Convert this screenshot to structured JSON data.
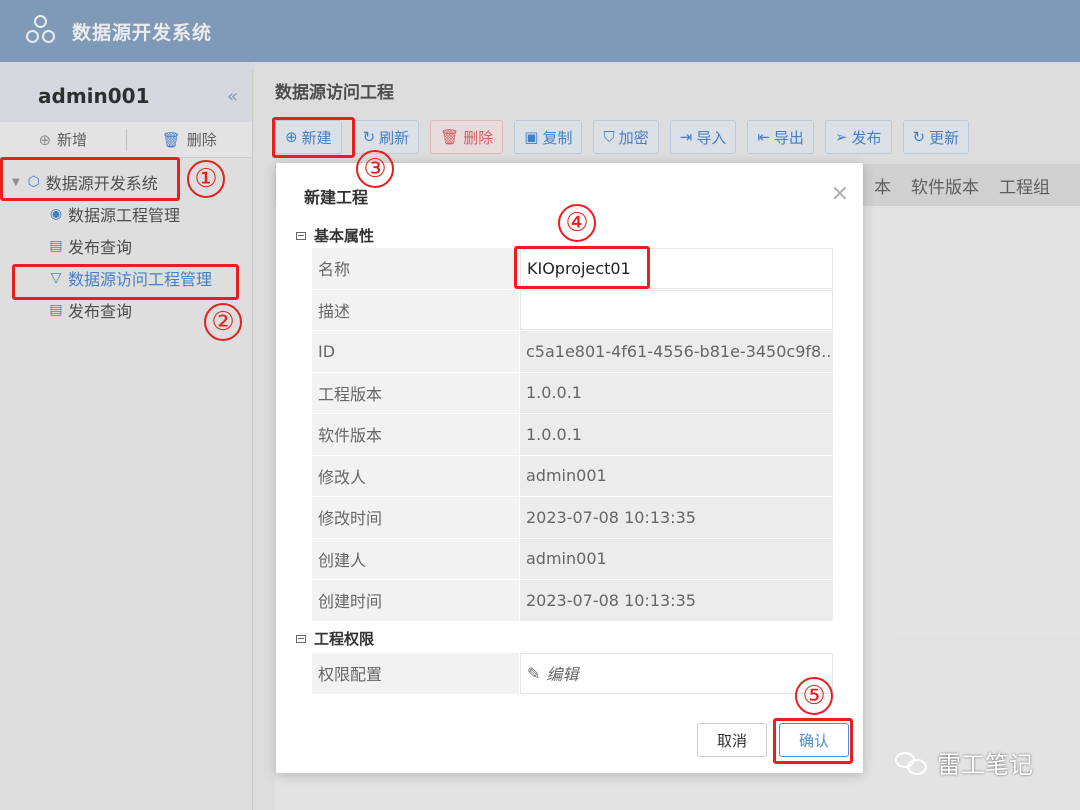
{
  "app": {
    "title": "数据源开发系统"
  },
  "sidebar": {
    "user": "admin001",
    "collapse_glyph": "«",
    "add_label": "新增",
    "delete_label": "删除",
    "tree": [
      {
        "label": "数据源开发系统",
        "level": 0,
        "icon": "cube-icon"
      },
      {
        "label": "数据源工程管理",
        "level": 1,
        "icon": "database-icon"
      },
      {
        "label": "发布查询",
        "level": 1,
        "icon": "document-icon"
      },
      {
        "label": "数据源访问工程管理",
        "level": 1,
        "icon": "funnel-icon",
        "active": true
      },
      {
        "label": "发布查询",
        "level": 1,
        "icon": "document-icon"
      }
    ]
  },
  "main": {
    "title": "数据源访问工程",
    "toolbar": [
      {
        "label": "新建",
        "icon": "plus-circle-icon"
      },
      {
        "label": "刷新",
        "icon": "refresh-icon"
      },
      {
        "label": "删除",
        "icon": "trash-icon"
      },
      {
        "label": "复制",
        "icon": "copy-icon"
      },
      {
        "label": "加密",
        "icon": "shield-icon"
      },
      {
        "label": "导入",
        "icon": "import-icon"
      },
      {
        "label": "导出",
        "icon": "export-icon"
      },
      {
        "label": "发布",
        "icon": "send-icon"
      },
      {
        "label": "更新",
        "icon": "update-icon"
      }
    ],
    "columns": [
      "本",
      "软件版本",
      "工程组"
    ]
  },
  "dialog": {
    "title": "新建工程",
    "close": "×",
    "section_basic": "基本属性",
    "section_perm": "工程权限",
    "props": [
      {
        "key": "名称",
        "value": "KIOproject01"
      },
      {
        "key": "描述",
        "value": ""
      },
      {
        "key": "ID",
        "value": "c5a1e801-4f61-4556-b81e-3450c9f8..."
      },
      {
        "key": "工程版本",
        "value": "1.0.0.1"
      },
      {
        "key": "软件版本",
        "value": "1.0.0.1"
      },
      {
        "key": "修改人",
        "value": "admin001"
      },
      {
        "key": "修改时间",
        "value": "2023-07-08 10:13:35"
      },
      {
        "key": "创建人",
        "value": "admin001"
      },
      {
        "key": "创建时间",
        "value": "2023-07-08 10:13:35"
      }
    ],
    "perm_key": "权限配置",
    "perm_edit": "编辑",
    "cancel": "取消",
    "ok": "确认"
  },
  "annotations": [
    "①",
    "②",
    "③",
    "④",
    "⑤"
  ],
  "watermark": "雷工笔记",
  "colors": {
    "header": "#8aa6c9",
    "accent": "#4d8ad8",
    "highlight": "#e8201d"
  }
}
